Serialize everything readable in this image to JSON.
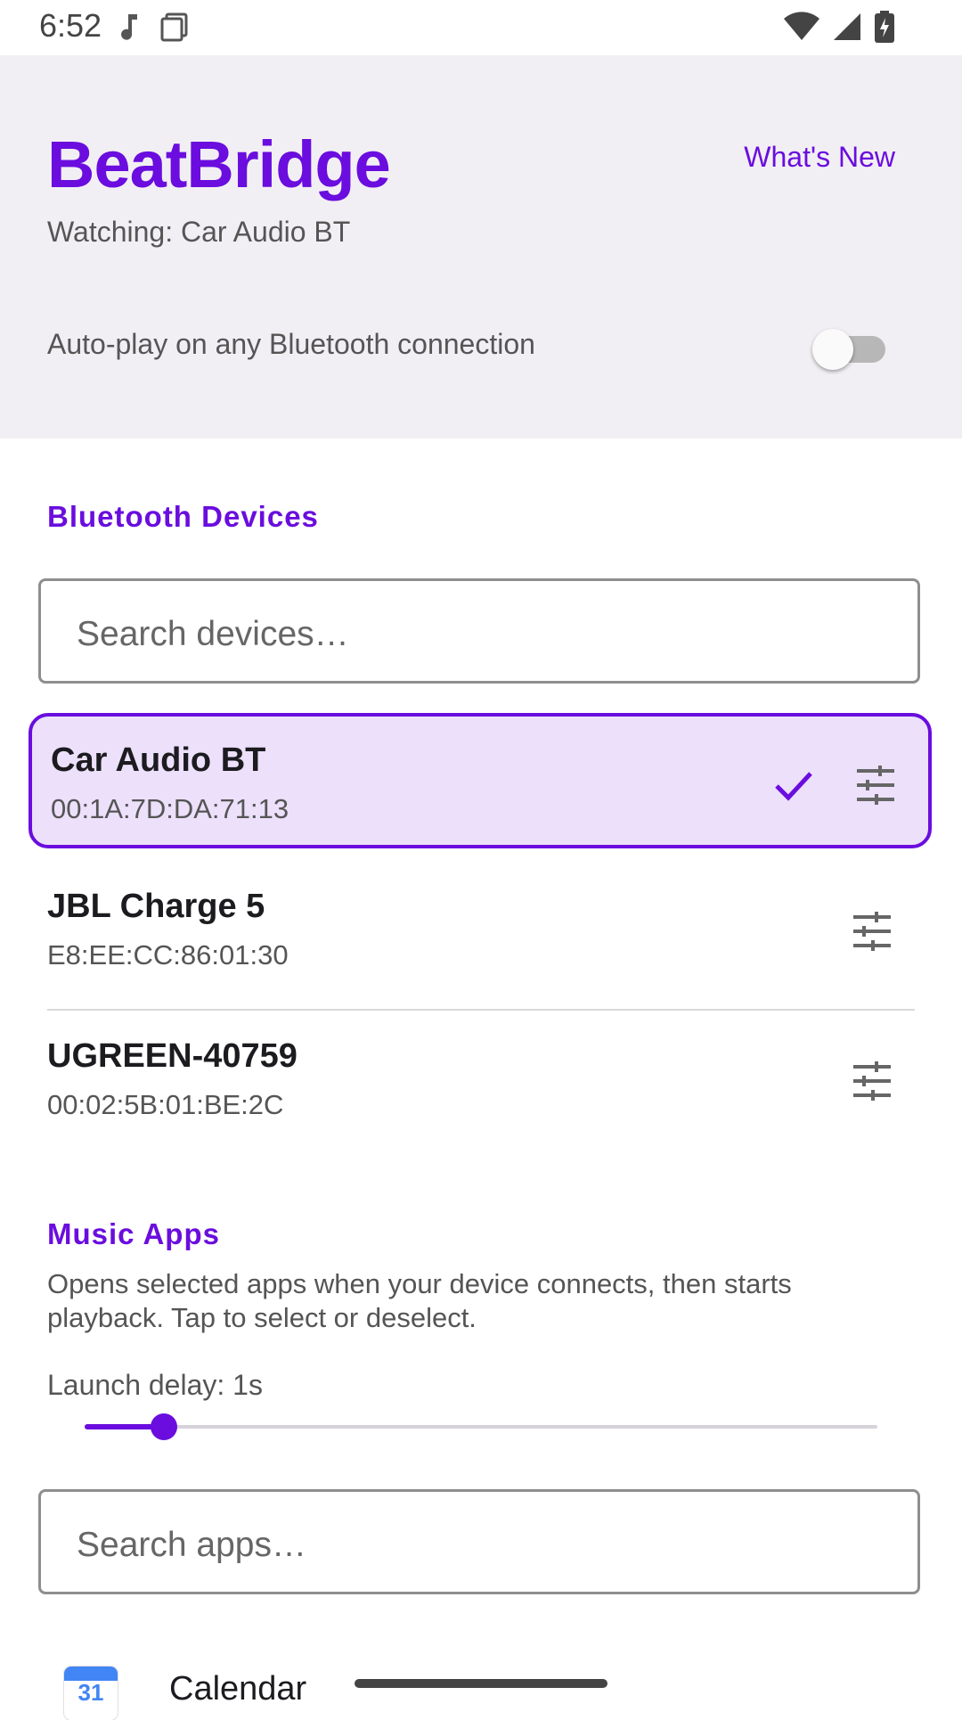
{
  "status_bar": {
    "time": "6:52"
  },
  "header": {
    "app_title": "BeatBridge",
    "whats_new": "What's New",
    "watching": "Watching: Car Audio BT",
    "autoplay_label": "Auto-play on any Bluetooth connection",
    "autoplay_enabled": false
  },
  "bluetooth": {
    "section_title": "Bluetooth Devices",
    "search_placeholder": "Search devices…",
    "devices": [
      {
        "name": "Car Audio BT",
        "mac": "00:1A:7D:DA:71:13",
        "selected": true
      },
      {
        "name": "JBL Charge 5",
        "mac": "E8:EE:CC:86:01:30",
        "selected": false
      },
      {
        "name": "UGREEN-40759",
        "mac": "00:02:5B:01:BE:2C",
        "selected": false
      }
    ]
  },
  "music_apps": {
    "section_title": "Music Apps",
    "description": "Opens selected apps when your device connects, then starts playback. Tap to select or deselect.",
    "launch_delay_label": "Launch delay: 1s",
    "launch_delay_fraction": 0.1,
    "search_placeholder": "Search apps…",
    "apps": [
      {
        "name": "Calendar",
        "icon_text": "31"
      }
    ]
  },
  "colors": {
    "accent": "#6a0dde",
    "header_bg": "#f2eff4",
    "selected_bg": "#ece0fb"
  }
}
